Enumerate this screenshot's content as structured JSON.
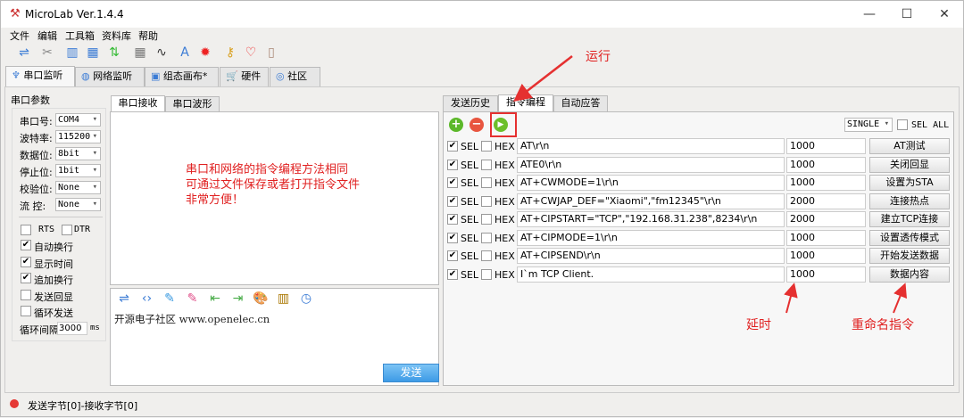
{
  "window": {
    "title": "MicroLab Ver.1.4.4",
    "minimize": "—",
    "maximize": "☐",
    "close": "✕"
  },
  "menu": [
    "文件",
    "编辑",
    "工具箱",
    "资料库",
    "帮助"
  ],
  "toolbar_icons": [
    "connect-icon",
    "disconnect-icon",
    "layout-icon",
    "window-icon",
    "updown-arrows-icon",
    "calculator-icon",
    "plug-icon",
    "font-icon",
    "flame-icon",
    "key-icon",
    "heart-icon",
    "book-icon"
  ],
  "main_tabs": [
    "串口监听",
    "网络监听",
    "组态画布*",
    "硬件",
    "社区"
  ],
  "serial": {
    "group_title": "串口参数",
    "fields": [
      {
        "label": "串口号:",
        "value": "COM4"
      },
      {
        "label": "波特率:",
        "value": "115200"
      },
      {
        "label": "数据位:",
        "value": "8bit"
      },
      {
        "label": "停止位:",
        "value": "1bit"
      },
      {
        "label": "校验位:",
        "value": "None"
      },
      {
        "label": "流  控:",
        "value": "None"
      }
    ],
    "rts": "RTS",
    "dtr": "DTR",
    "options": [
      {
        "label": "自动换行",
        "checked": true
      },
      {
        "label": "显示时间",
        "checked": true
      },
      {
        "label": "追加换行",
        "checked": true
      },
      {
        "label": "发送回显",
        "checked": false
      },
      {
        "label": "循环发送",
        "checked": false
      }
    ],
    "interval_label": "循环间隔",
    "interval_value": "3000",
    "interval_unit": "ms"
  },
  "receive": {
    "tabs": [
      "串口接收",
      "串口波形"
    ],
    "annotation": [
      "串口和网络的指令编程方法相同",
      "可通过文件保存或者打开指令文件",
      "非常方便！"
    ]
  },
  "send": {
    "text": "开源电子社区 www.openelec.cn",
    "button": "发送"
  },
  "cmd": {
    "tabs": [
      "发送历史",
      "指令编程",
      "自动应答"
    ],
    "mode": "SINGLE",
    "sel_all": "SEL ALL",
    "sel": "SEL",
    "hex": "HEX",
    "rows": [
      {
        "cmd": "AT\\r\\n",
        "delay": "1000",
        "name": "AT测试"
      },
      {
        "cmd": "ATE0\\r\\n",
        "delay": "1000",
        "name": "关闭回显"
      },
      {
        "cmd": "AT+CWMODE=1\\r\\n",
        "delay": "1000",
        "name": "设置为STA"
      },
      {
        "cmd": "AT+CWJAP_DEF=\"Xiaomi\",\"fm12345\"\\r\\n",
        "delay": "2000",
        "name": "连接热点"
      },
      {
        "cmd": "AT+CIPSTART=\"TCP\",\"192.168.31.238\",8234\\r\\n",
        "delay": "2000",
        "name": "建立TCP连接"
      },
      {
        "cmd": "AT+CIPMODE=1\\r\\n",
        "delay": "1000",
        "name": "设置透传模式"
      },
      {
        "cmd": "AT+CIPSEND\\r\\n",
        "delay": "1000",
        "name": "开始发送数据"
      },
      {
        "cmd": "I`m TCP Client.",
        "delay": "1000",
        "name": "数据内容"
      }
    ]
  },
  "annotations": {
    "run": "运行",
    "delay": "延时",
    "rename": "重命名指令"
  },
  "status": {
    "text": "发送字节[0]-接收字节[0]",
    "indicator_color": "#e53935"
  }
}
